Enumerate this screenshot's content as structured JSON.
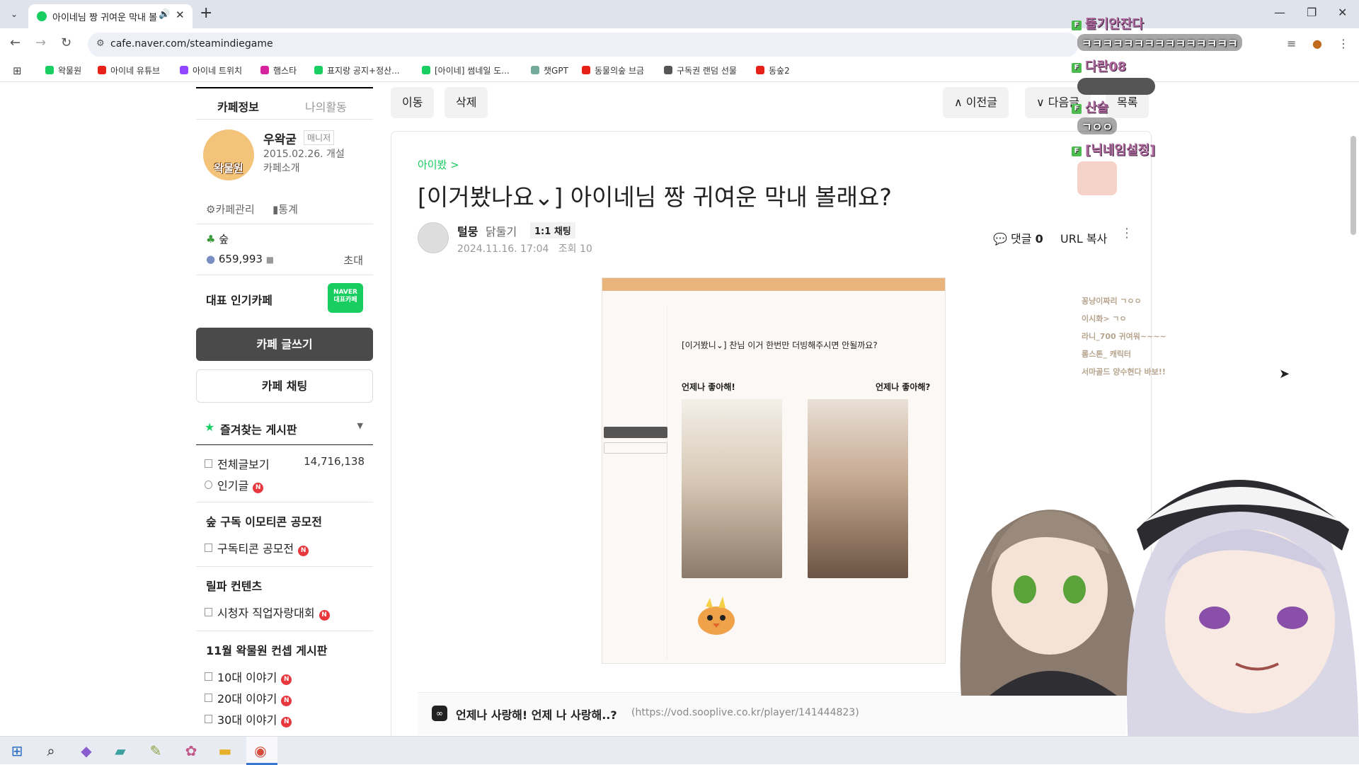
{
  "browser": {
    "tab_title": "아이네님 짱 귀여운 막내 볼",
    "tab_audio_icon": "speaker-icon",
    "url": "cafe.naver.com/steamindiegame",
    "bookmarks": [
      "왁물원",
      "아이네 유튜브",
      "아이네 트위치",
      "햄스타",
      "표지랑 공지+정산...",
      "[아이네] 썸네일 도...",
      "챗GPT",
      "동물의숲 브금",
      "구독권 랜덤 선물",
      "동숲2"
    ]
  },
  "sidebar": {
    "tabs": [
      "카페정보",
      "나의활동"
    ],
    "cafe_name": "우왁굳",
    "manager_badge": "매니저",
    "cafe_logo_text": "왁물원",
    "founded": "2015.02.26. 개설",
    "intro_link": "카페소개",
    "manage_link": "카페관리",
    "stats_link": "통계",
    "level_name": "숲",
    "member_count": "659,993",
    "invite": "초대",
    "rep_label": "대표 인기카페",
    "naver_badge_top": "NAVER",
    "naver_badge_bottom": "대표카페",
    "write_button": "카페 글쓰기",
    "chat_button": "카페 채팅",
    "favorites_label": "즐겨찾는 게시판",
    "boards_top": [
      {
        "label": "전체글보기",
        "count": "14,716,138"
      },
      {
        "label": "인기글",
        "count": ""
      }
    ],
    "section_emoticon": "숲 구독 이모티콘 공모전",
    "board_emoticon": "구독티콘 공모전",
    "section_reelpa": "릴파 컨텐츠",
    "board_reelpa": "시청자 직업자랑대회",
    "section_nov": "11월 왁물원 컨셉 게시판",
    "boards_nov": [
      "10대 이야기",
      "20대 이야기",
      "30대 이야기"
    ],
    "new_badge": "N"
  },
  "main": {
    "move_button": "이동",
    "delete_button": "삭제",
    "prev_button": "이전글",
    "next_button": "다음글",
    "list_button": "목록",
    "board_link": "아이봤 >",
    "title": "[이거봤나요⌄] 아이네님 짱 귀여운 막내 볼래요?",
    "author": "털뭉",
    "author_grade": "닭둘기",
    "chat_tag": "1:1 채팅",
    "date": "2024.11.16. 17:04",
    "views": "조회 10",
    "comment_label": "댓글",
    "comment_count": "0",
    "url_copy": "URL 복사"
  },
  "embed": {
    "shot_title": "[이거봤니⌄] 찬님 이거 한번만 더빙해주시면 안될까요?",
    "shot_label_left": "언제나 좋아해!",
    "shot_label_right": "언제나 좋아해?",
    "chat_lines": [
      "꽁냥이짜리 ㄱㅇㅇ",
      "이시화> ㄱㅇ",
      "라니_700 귀여워~~~~",
      "롬스톤_ 캐릭터",
      "서마골드 양수현다 바보!!"
    ],
    "video_title": "언제나 사랑해! 언제 나 사랑해..?",
    "video_url": "(https://vod.sooplive.co.kr/player/141444823)"
  },
  "stream_chat": [
    {
      "name": "뚤기안잔다",
      "message": "ㅋㅋㅋㅋㅋㅋㅋㅋㅋㅋㅋㅋㅋㅋㅋ"
    },
    {
      "name": "다란08",
      "message": ""
    },
    {
      "name": "산슬",
      "message": "ㄱㅇㅇ"
    },
    {
      "name": "[닉네임설정]",
      "message": ""
    }
  ],
  "colors": {
    "naver_green": "#19ce60",
    "new_red": "#e8383d",
    "write_button": "#4a4a4a"
  }
}
